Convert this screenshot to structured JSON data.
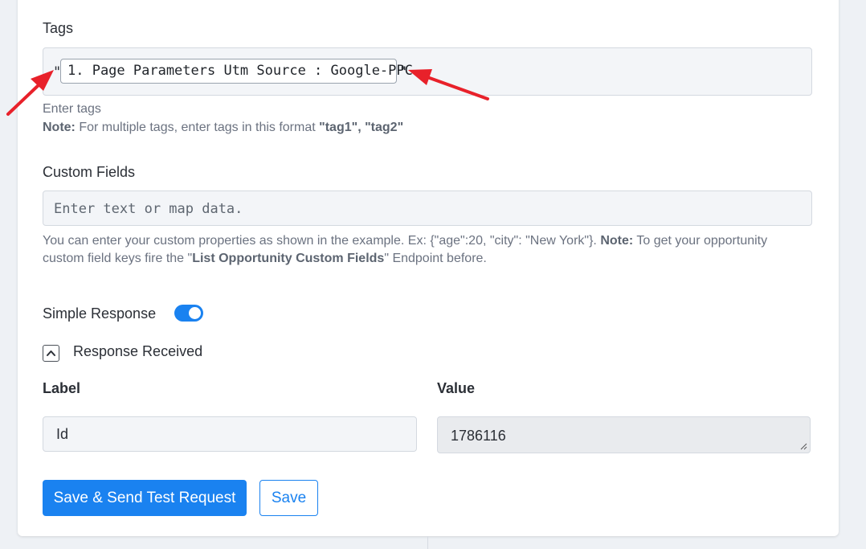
{
  "tags": {
    "label": "Tags",
    "quote_open": "\"",
    "quote_close": "\"",
    "chip_text": "1. Page Parameters Utm Source : Google-PPC",
    "help_line1": "Enter tags",
    "help_note_label": "Note:",
    "help_note_text": " For multiple tags, enter tags in this format ",
    "help_note_example": "\"tag1\", \"tag2\""
  },
  "custom_fields": {
    "label": "Custom Fields",
    "placeholder": "Enter text or map data.",
    "help_text1": "You can enter your custom properties as shown in the example. Ex: {\"age\":20, \"city\": \"New York\"}. ",
    "help_note_label": "Note:",
    "help_text2": " To get your opportunity custom field keys fire the \"",
    "help_endpoint": "List Opportunity Custom Fields",
    "help_text3": "\" Endpoint before."
  },
  "simple_response": {
    "label": "Simple Response",
    "enabled": true
  },
  "response_received": {
    "label": "Response Received",
    "expanded": true,
    "label_header": "Label",
    "value_header": "Value",
    "row": {
      "label": "Id",
      "value": "1786116"
    }
  },
  "buttons": {
    "save_and_test": "Save & Send Test Request",
    "save": "Save"
  },
  "colors": {
    "accent": "#1a82f0",
    "annotation_arrow": "#e8212a"
  }
}
